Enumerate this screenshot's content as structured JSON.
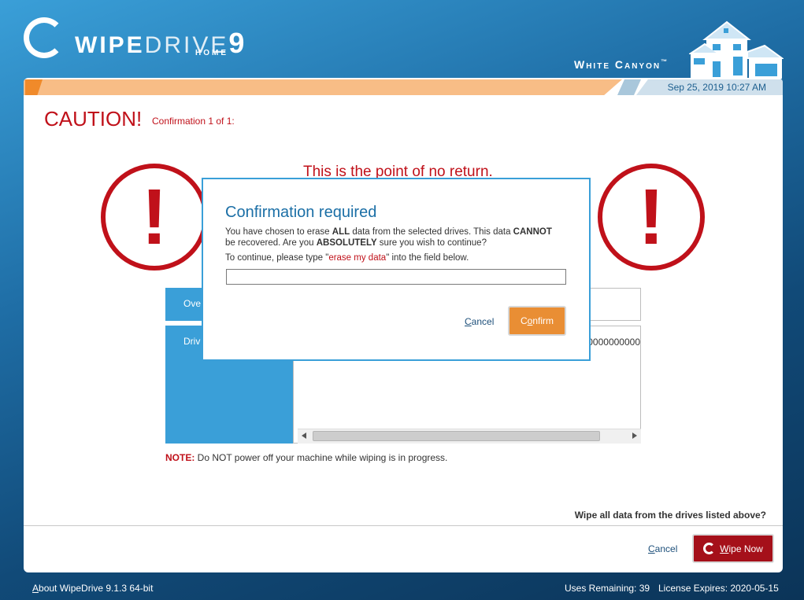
{
  "header": {
    "logo_bold": "WIPE",
    "logo_thin": "DRIVE",
    "logo_number": "9",
    "logo_sub": "HOME",
    "brand": "White Canyon",
    "brand_tm": "™"
  },
  "status": {
    "datetime": "Sep 25, 2019 10:27 AM"
  },
  "main": {
    "caution": "CAUTION!",
    "confirmation_count": "Confirmation 1 of 1:",
    "no_return": "This is the point of no return.",
    "warning_glyph": "!",
    "rows": [
      {
        "header": "Ove",
        "value": ""
      },
      {
        "header": "Driv",
        "value": "0000000000000"
      }
    ],
    "note_label": "NOTE:",
    "note_text": " Do NOT power off your machine while wiping is in progress.",
    "question": "Wipe all data from the drives listed above?",
    "cancel_first": "C",
    "cancel_rest": "ancel",
    "wipe_first": "W",
    "wipe_rest": "ipe Now"
  },
  "dialog": {
    "title": "Confirmation required",
    "msg_1": "You have chosen to erase ",
    "msg_all": "ALL",
    "msg_2": " data from the selected drives. This data ",
    "msg_cannot": "CANNOT",
    "msg_3": " be recovered. Are you ",
    "msg_absolutely": "ABSOLUTELY",
    "msg_4": " sure you wish to continue?",
    "instruction_pre": "To continue, please type \"",
    "instruction_phrase": "erase my data",
    "instruction_post": "\" into the field below.",
    "input_value": "",
    "cancel_first": "C",
    "cancel_rest": "ancel",
    "confirm_a": "C",
    "confirm_b": "o",
    "confirm_c": "nfirm"
  },
  "footer": {
    "about_first": "A",
    "about_rest": "bout WipeDrive 9.1.3 64-bit",
    "uses_remaining": "Uses Remaining: 39",
    "license_expires": "License Expires: 2020-05-15"
  },
  "colors": {
    "accent_blue": "#3a9fd8",
    "caution_red": "#c0111a",
    "confirm_orange": "#e98e34",
    "wipe_red": "#a5101a"
  },
  "icons": [
    "logo-ring-icon",
    "house-icon",
    "warning-icon",
    "wipe-ring-icon"
  ]
}
